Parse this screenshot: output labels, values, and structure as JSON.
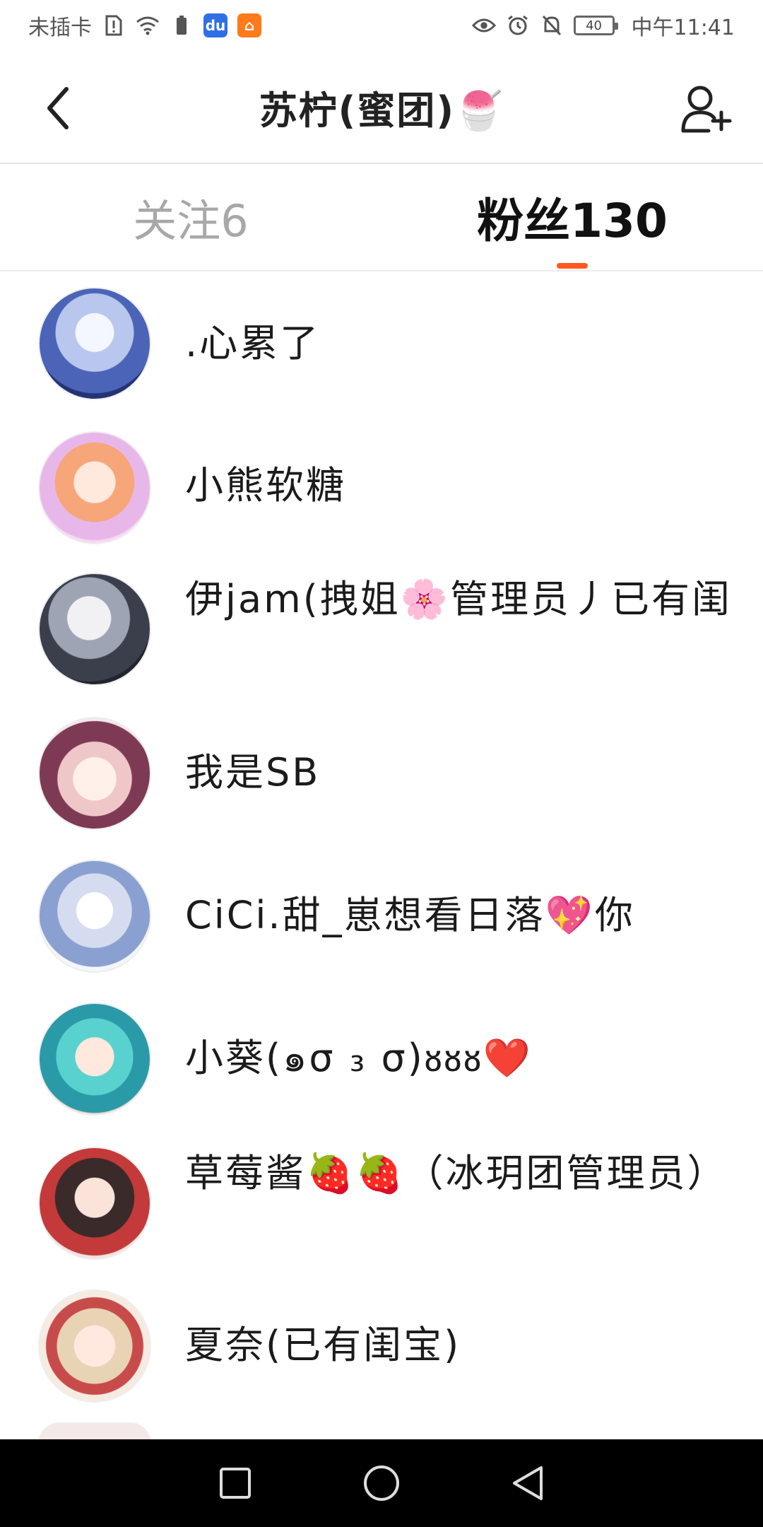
{
  "status_bar": {
    "carrier": "未插卡",
    "battery_level": "40",
    "time": "中午11:41"
  },
  "header": {
    "title": "苏柠(蜜团)🍧"
  },
  "tabs": [
    {
      "label": "关注6",
      "selected": false
    },
    {
      "label": "粉丝130",
      "selected": true
    }
  ],
  "accent_color": "#ff5a1f",
  "followers": [
    {
      "name": ".心累了"
    },
    {
      "name": "小熊软糖"
    },
    {
      "name": "伊jam(拽姐🌸管理员丿已有闺"
    },
    {
      "name": "我是SB"
    },
    {
      "name": "CiCi.甜_崽想看日落💖你"
    },
    {
      "name": "小葵(๑σ ₃ σ)ᴕᴕᴕ❤️"
    },
    {
      "name": "草莓酱🍓🍓（冰玥团管理员）"
    },
    {
      "name": "夏奈(已有闺宝)"
    }
  ]
}
